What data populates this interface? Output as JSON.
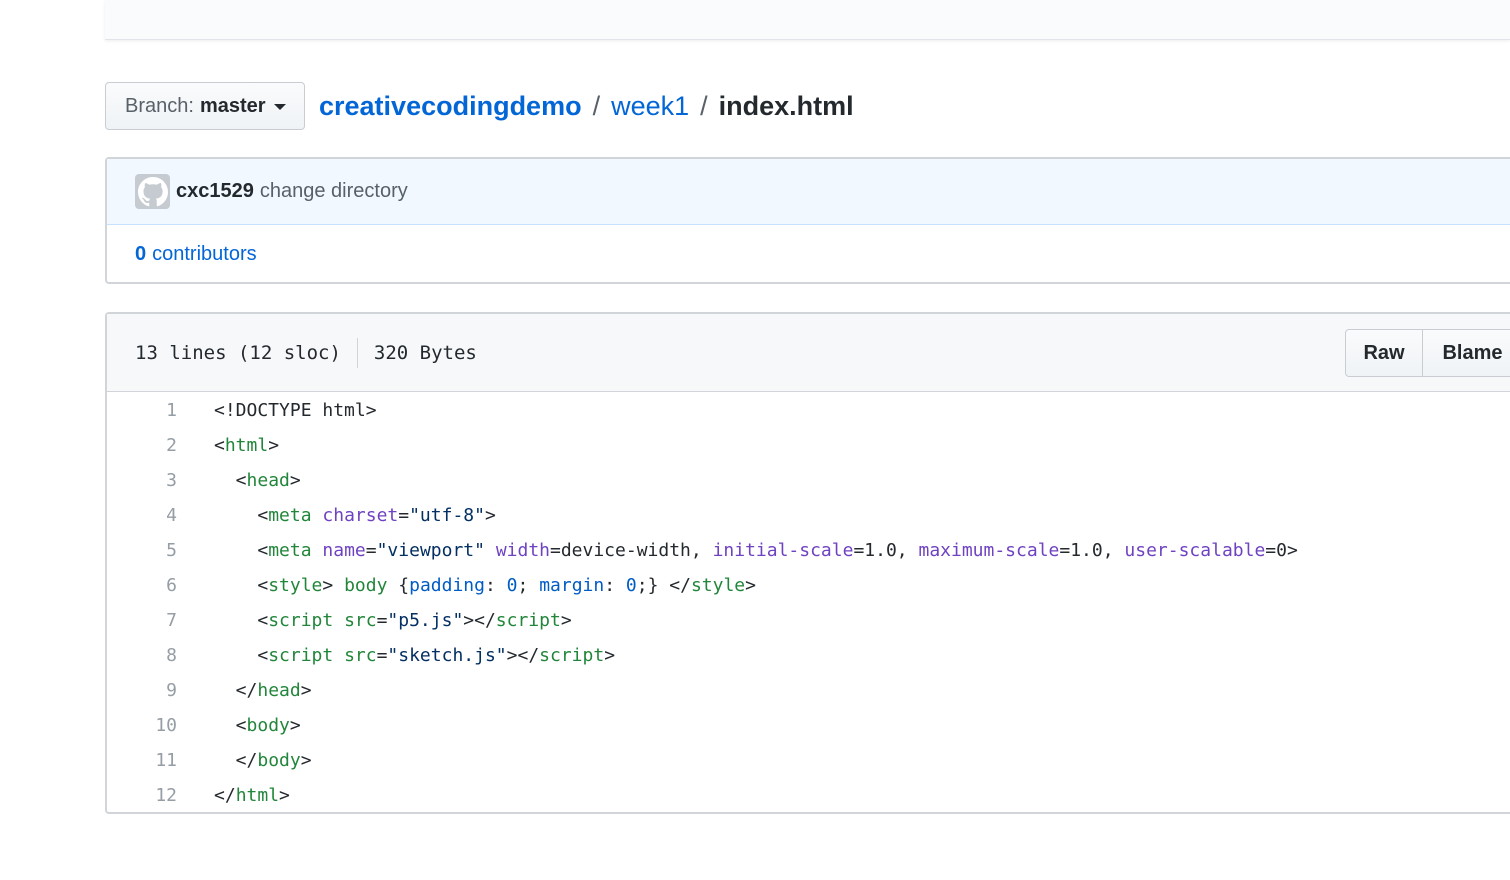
{
  "branch": {
    "prefix": "Branch:",
    "name": "master"
  },
  "breadcrumb": {
    "repo": "creativecodingdemo",
    "separator": "/",
    "folder": "week1",
    "file": "index.html"
  },
  "commit": {
    "author": "cxc1529",
    "message": "change directory"
  },
  "contributors": {
    "count": "0",
    "label": "contributors"
  },
  "file_info": {
    "lines": "13 lines (12 sloc)",
    "size": "320 Bytes"
  },
  "buttons": {
    "raw": "Raw",
    "blame": "Blame"
  },
  "code": {
    "line_numbers": [
      "1",
      "2",
      "3",
      "4",
      "5",
      "6",
      "7",
      "8",
      "9",
      "10",
      "11",
      "12"
    ],
    "lines": [
      [
        {
          "t": "<!DOCTYPE html>",
          "c": ""
        }
      ],
      [
        {
          "t": "<",
          "c": ""
        },
        {
          "t": "html",
          "c": "tag"
        },
        {
          "t": ">",
          "c": ""
        }
      ],
      [
        {
          "t": "  <",
          "c": ""
        },
        {
          "t": "head",
          "c": "tag"
        },
        {
          "t": ">",
          "c": ""
        }
      ],
      [
        {
          "t": "    <",
          "c": ""
        },
        {
          "t": "meta",
          "c": "tag"
        },
        {
          "t": " ",
          "c": ""
        },
        {
          "t": "charset",
          "c": "attr"
        },
        {
          "t": "=",
          "c": ""
        },
        {
          "t": "\"utf-8\"",
          "c": "str"
        },
        {
          "t": ">",
          "c": ""
        }
      ],
      [
        {
          "t": "    <",
          "c": ""
        },
        {
          "t": "meta",
          "c": "tag"
        },
        {
          "t": " ",
          "c": ""
        },
        {
          "t": "name",
          "c": "attr"
        },
        {
          "t": "=",
          "c": ""
        },
        {
          "t": "\"viewport\"",
          "c": "str"
        },
        {
          "t": " ",
          "c": ""
        },
        {
          "t": "width",
          "c": "attr"
        },
        {
          "t": "=device-width, ",
          "c": ""
        },
        {
          "t": "initial-scale",
          "c": "attr"
        },
        {
          "t": "=1.0, ",
          "c": ""
        },
        {
          "t": "maximum-scale",
          "c": "attr"
        },
        {
          "t": "=1.0, ",
          "c": ""
        },
        {
          "t": "user-scalable",
          "c": "attr"
        },
        {
          "t": "=0>",
          "c": ""
        }
      ],
      [
        {
          "t": "    <",
          "c": ""
        },
        {
          "t": "style",
          "c": "tag"
        },
        {
          "t": "> ",
          "c": ""
        },
        {
          "t": "body",
          "c": "tag"
        },
        {
          "t": " {",
          "c": ""
        },
        {
          "t": "padding",
          "c": "prop"
        },
        {
          "t": ": ",
          "c": ""
        },
        {
          "t": "0",
          "c": "num"
        },
        {
          "t": "; ",
          "c": ""
        },
        {
          "t": "margin",
          "c": "prop"
        },
        {
          "t": ": ",
          "c": ""
        },
        {
          "t": "0",
          "c": "num"
        },
        {
          "t": ";} </",
          "c": ""
        },
        {
          "t": "style",
          "c": "tag"
        },
        {
          "t": ">",
          "c": ""
        }
      ],
      [
        {
          "t": "    <",
          "c": ""
        },
        {
          "t": "script",
          "c": "tag"
        },
        {
          "t": " ",
          "c": ""
        },
        {
          "t": "src",
          "c": "tag"
        },
        {
          "t": "=",
          "c": ""
        },
        {
          "t": "\"p5.js\"",
          "c": "str"
        },
        {
          "t": "></",
          "c": ""
        },
        {
          "t": "script",
          "c": "tag"
        },
        {
          "t": ">",
          "c": ""
        }
      ],
      [
        {
          "t": "    <",
          "c": ""
        },
        {
          "t": "script",
          "c": "tag"
        },
        {
          "t": " ",
          "c": ""
        },
        {
          "t": "src",
          "c": "tag"
        },
        {
          "t": "=",
          "c": ""
        },
        {
          "t": "\"sketch.js\"",
          "c": "str"
        },
        {
          "t": "></",
          "c": ""
        },
        {
          "t": "script",
          "c": "tag"
        },
        {
          "t": ">",
          "c": ""
        }
      ],
      [
        {
          "t": "  </",
          "c": ""
        },
        {
          "t": "head",
          "c": "tag"
        },
        {
          "t": ">",
          "c": ""
        }
      ],
      [
        {
          "t": "  <",
          "c": ""
        },
        {
          "t": "body",
          "c": "tag"
        },
        {
          "t": ">",
          "c": ""
        }
      ],
      [
        {
          "t": "  </",
          "c": ""
        },
        {
          "t": "body",
          "c": "tag"
        },
        {
          "t": ">",
          "c": ""
        }
      ],
      [
        {
          "t": "</",
          "c": ""
        },
        {
          "t": "html",
          "c": "tag"
        },
        {
          "t": ">",
          "c": ""
        }
      ]
    ]
  },
  "icons": {
    "avatar": "github-octocat-icon",
    "branch_caret": "caret-down-icon"
  },
  "colors": {
    "link": "#0366d6",
    "tag": "#22863a",
    "attr": "#6f42c1",
    "string": "#032f62",
    "number": "#005cc5",
    "commit_bg": "#f1f8ff"
  }
}
